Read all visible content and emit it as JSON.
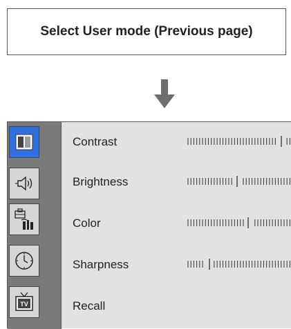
{
  "caption": {
    "text": "Select User mode (Previous page)"
  },
  "icons": {
    "arrow": "arrow-down-icon",
    "picture": "picture-icon",
    "sound": "speaker-icon",
    "setup": "toolbox-icon",
    "time": "clock-icon",
    "tv": "tv-icon"
  },
  "colors": {
    "active_tab": "#2f6fe0",
    "panel": "#e2e2e2",
    "sidebar": "#7a7a7a"
  },
  "tabs": [
    {
      "icon": "picture-icon",
      "active": true,
      "tv_text": ""
    },
    {
      "icon": "speaker-icon",
      "active": false,
      "tv_text": ""
    },
    {
      "icon": "toolbox-icon",
      "active": false,
      "tv_text": ""
    },
    {
      "icon": "clock-icon",
      "active": false,
      "tv_text": ""
    },
    {
      "icon": "tv-icon",
      "active": false,
      "tv_text": "TV"
    }
  ],
  "menu": {
    "items": [
      {
        "label": "Contrast",
        "value_fraction": 0.85
      },
      {
        "label": "Brightness",
        "value_fraction": 0.45
      },
      {
        "label": "Color",
        "value_fraction": 0.55
      },
      {
        "label": "Sharpness",
        "value_fraction": 0.2
      },
      {
        "label": "Recall"
      }
    ]
  }
}
